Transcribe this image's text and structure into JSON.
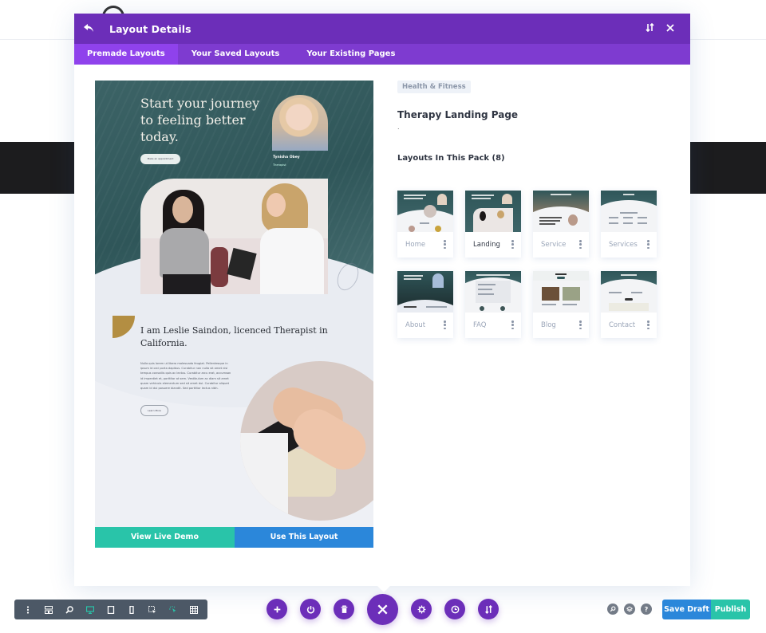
{
  "modal": {
    "title": "Layout Details",
    "back_icon": "back-arrow-icon",
    "header_icons": [
      "sort-icon",
      "close-icon"
    ]
  },
  "tabs": [
    {
      "label": "Premade Layouts",
      "active": true
    },
    {
      "label": "Your Saved Layouts",
      "active": false
    },
    {
      "label": "Your Existing Pages",
      "active": false
    }
  ],
  "preview": {
    "hero_heading": "Start your journey to feeling better today.",
    "hero_button": "Make an appointment",
    "therapist_name": "Tynisha Obey",
    "therapist_role": "Therapist",
    "about_heading": "I am Leslie Saindon, licenced Therapist in California.",
    "about_body": "Nulla quis lorem ut libero malesuada feugiat. Pellentesque in ipsum id orci porta dapibus. Curabitur non nulla sit amet nisl tempus convallis quis ac lectus. Curabitur arcu erat, accumsan id imperdiet et, porttitor at sem. Vestibulum ac diam sit amet quam vehicula elementum sed sit amet dui. Curabitur aliquet quam id dui posuere blandit. Sed porttitor lectus nibh.",
    "about_button": "Learn More",
    "view_demo_label": "View Live Demo",
    "use_layout_label": "Use This Layout"
  },
  "details": {
    "category": "Health & Fitness",
    "title": "Therapy Landing Page",
    "description": ".",
    "pack_heading": "Layouts In This Pack (8)"
  },
  "layouts": [
    {
      "label": "Home",
      "active": false
    },
    {
      "label": "Landing",
      "active": true
    },
    {
      "label": "Service",
      "active": false
    },
    {
      "label": "Services",
      "active": false
    },
    {
      "label": "About",
      "active": false
    },
    {
      "label": "FAQ",
      "active": false
    },
    {
      "label": "Blog",
      "active": false
    },
    {
      "label": "Contact",
      "active": false
    }
  ],
  "toolbar": {
    "left_group": [
      "menu-dots-icon",
      "wireframe-icon",
      "zoom-icon",
      "desktop-icon",
      "tablet-icon",
      "phone-icon"
    ],
    "left_group2": [
      "select-icon",
      "hover-icon",
      "grid-icon"
    ],
    "center": [
      "add-icon",
      "power-icon",
      "trash-icon",
      "close-icon",
      "settings-icon",
      "history-icon",
      "sort-icon"
    ],
    "right_icons": [
      "search-icon",
      "layers-icon",
      "help-icon"
    ],
    "save_draft_label": "Save Draft",
    "publish_label": "Publish"
  },
  "colors": {
    "header_purple": "#6c2eb9",
    "tab_purple": "#7e3bd0",
    "active_tab": "#8f42ec",
    "teal": "#29c4a9",
    "blue": "#2b87da"
  }
}
